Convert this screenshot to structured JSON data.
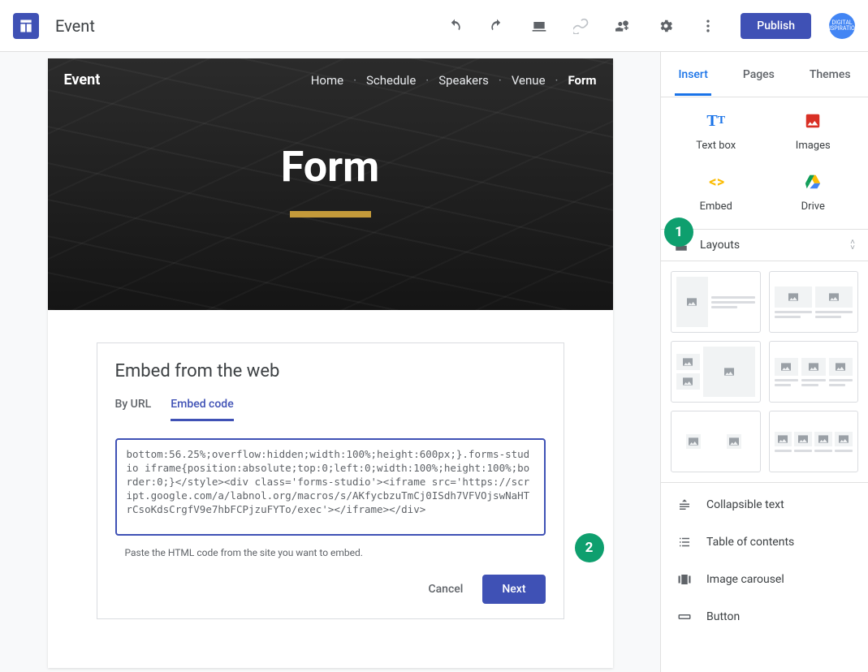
{
  "app": {
    "doc_title": "Event",
    "publish_label": "Publish",
    "avatar_text": "DIGITAL INSPIRATION"
  },
  "hero": {
    "site_title": "Event",
    "page_title": "Form",
    "nav": [
      "Home",
      "Schedule",
      "Speakers",
      "Venue",
      "Form"
    ],
    "current": "Form"
  },
  "dialog": {
    "title": "Embed from the web",
    "tabs": {
      "by_url": "By URL",
      "embed_code": "Embed code"
    },
    "active_tab": "embed_code",
    "code": "bottom:56.25%;overflow:hidden;width:100%;height:600px;}.forms-studio iframe{position:absolute;top:0;left:0;width:100%;height:100%;border:0;}</style><div class='forms-studio'><iframe src='https://script.google.com/a/labnol.org/macros/s/AKfycbzuTmCj0ISdh7VFVOjswNaHTrCsoKdsCrgfV9e7hbFCPjzuFYTo/exec'></iframe></div>",
    "hint": "Paste the HTML code from the site you want to embed.",
    "cancel": "Cancel",
    "next": "Next"
  },
  "badges": {
    "one": "1",
    "two": "2"
  },
  "sidebar": {
    "tabs": {
      "insert": "Insert",
      "pages": "Pages",
      "themes": "Themes"
    },
    "insert": {
      "text_box": "Text box",
      "images": "Images",
      "embed": "Embed",
      "drive": "Drive"
    },
    "layouts_label": "Layouts",
    "components": {
      "collapsible": "Collapsible text",
      "toc": "Table of contents",
      "carousel": "Image carousel",
      "button": "Button"
    }
  }
}
